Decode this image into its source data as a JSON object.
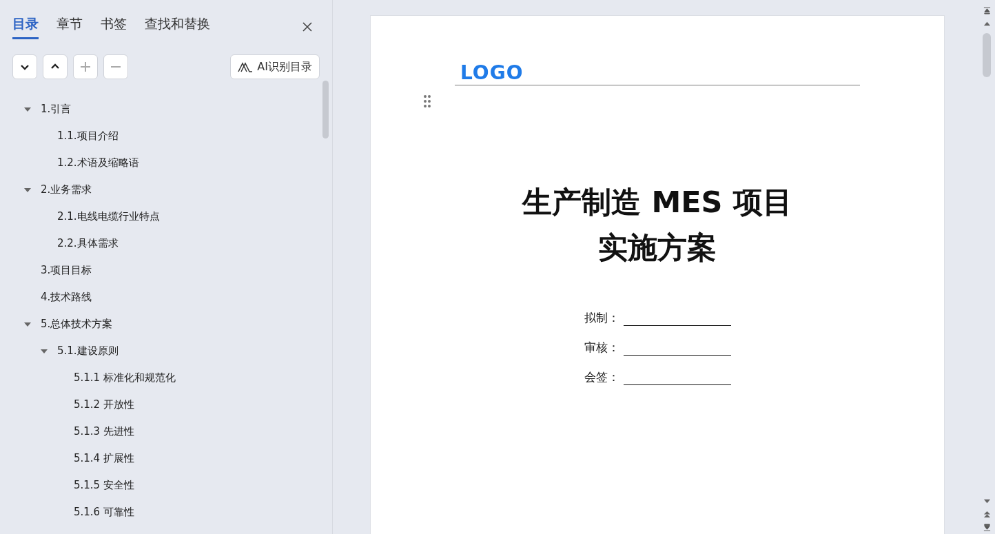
{
  "sidebar": {
    "tabs": [
      {
        "label": "目录",
        "selected": true
      },
      {
        "label": "章节",
        "selected": false
      },
      {
        "label": "书签",
        "selected": false
      },
      {
        "label": "查找和替换",
        "selected": false
      }
    ],
    "toolbar": [
      {
        "kind": "down",
        "disabled": false
      },
      {
        "kind": "up",
        "disabled": false
      },
      {
        "kind": "plus",
        "disabled": true
      },
      {
        "kind": "minus",
        "disabled": true
      }
    ],
    "ai_button": "AI识别目录",
    "outline": [
      {
        "label": "1.引言",
        "expanded": true,
        "children": [
          {
            "label": "1.1.项目介绍"
          },
          {
            "label": "1.2.术语及缩略语"
          }
        ]
      },
      {
        "label": "2.业务需求",
        "expanded": true,
        "children": [
          {
            "label": "2.1.电线电缆行业特点"
          },
          {
            "label": "2.2.具体需求"
          }
        ]
      },
      {
        "label": "3.项目目标"
      },
      {
        "label": "4.技术路线"
      },
      {
        "label": "5.总体技术方案",
        "expanded": true,
        "children": [
          {
            "label": "5.1.建设原则",
            "expanded": true,
            "children": [
              {
                "label": "5.1.1 标准化和规范化"
              },
              {
                "label": "5.1.2 开放性"
              },
              {
                "label": "5.1.3 先进性"
              },
              {
                "label": "5.1.4 扩展性"
              },
              {
                "label": "5.1.5 安全性"
              },
              {
                "label": "5.1.6 可靠性"
              }
            ]
          }
        ]
      }
    ]
  },
  "document": {
    "header_logo": "LOGO",
    "title_lines": [
      "生产制造 MES 项目",
      "实施方案"
    ],
    "sign_fields": [
      {
        "label": "拟制："
      },
      {
        "label": "审核："
      },
      {
        "label": "会签："
      }
    ]
  }
}
